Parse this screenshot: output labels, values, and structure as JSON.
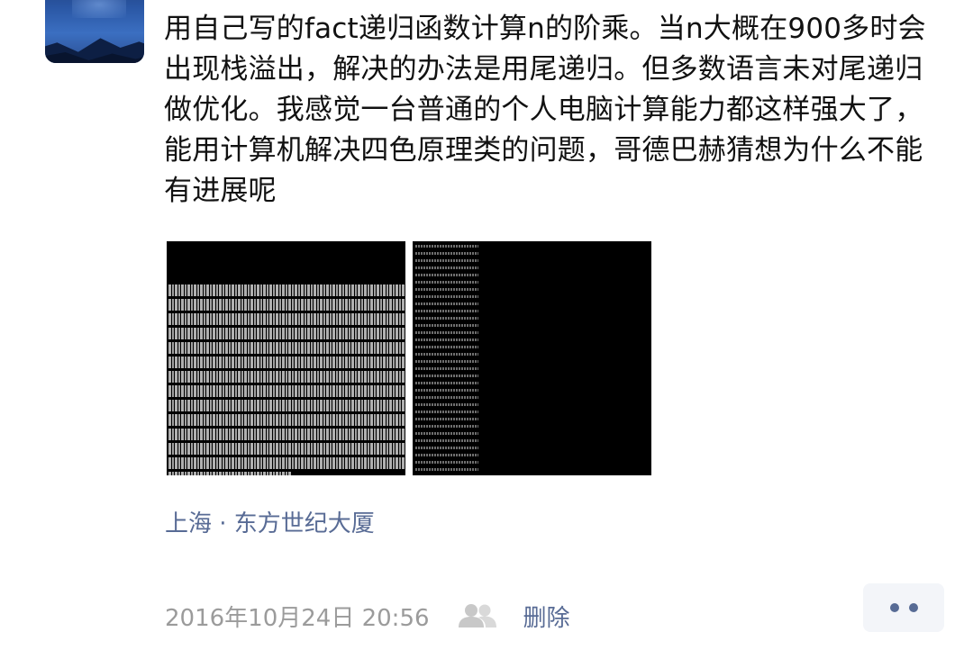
{
  "post": {
    "text": "用自己写的fact递归函数计算n的阶乘。当n大概在900多时会出现栈溢出，解决的办法是用尾递归。但多数语言未对尾递归做优化。我感觉一台普通的个人电脑计算能力都这样强大了，能用计算机解决四色原理类的问题，哥德巴赫猜想为什么不能有进展呢",
    "location": "上海 · 东方世纪大厦",
    "timestamp": "2016年10月24日 20:56",
    "delete_label": "删除"
  },
  "icons": {
    "friends": "friends-visibility-icon",
    "more": "more-dots-icon"
  },
  "colors": {
    "link": "#586b95",
    "text": "#111111",
    "meta": "#9b9b9b",
    "more_bg": "#f3f5f9"
  }
}
